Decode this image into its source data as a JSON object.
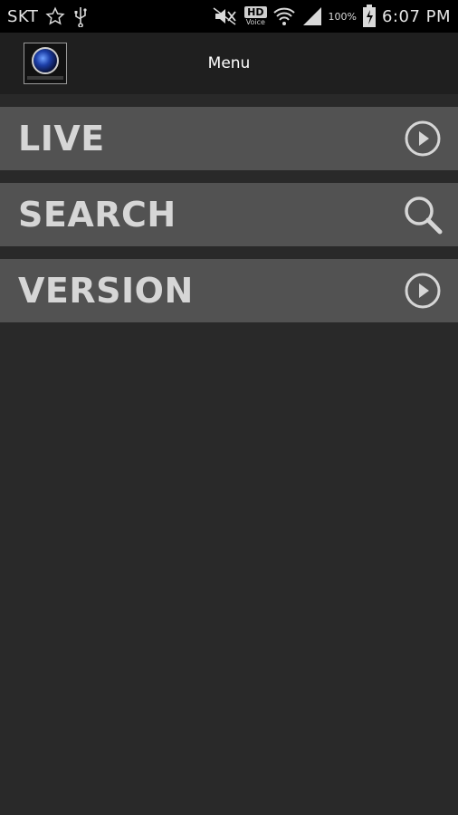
{
  "status_bar": {
    "carrier": "SKT",
    "hd_label": "HD",
    "voice_label": "Voice",
    "battery_percent": "100%",
    "time": "6:07 PM",
    "icons": [
      "star-icon",
      "usb-icon",
      "mute-icon",
      "wifi-icon",
      "signal-icon",
      "battery-charging-icon"
    ]
  },
  "app_bar": {
    "title": "Menu",
    "logo_icon": "camera-lens-logo"
  },
  "menu": {
    "items": [
      {
        "label": "LIVE",
        "icon": "play-circle-icon"
      },
      {
        "label": "SEARCH",
        "icon": "search-icon"
      },
      {
        "label": "VERSION",
        "icon": "play-circle-icon"
      }
    ]
  },
  "colors": {
    "background": "#292929",
    "app_bar": "#1f1f1f",
    "menu_item": "#525252",
    "menu_text": "#d6d6d6",
    "status_bar": "#000000"
  }
}
